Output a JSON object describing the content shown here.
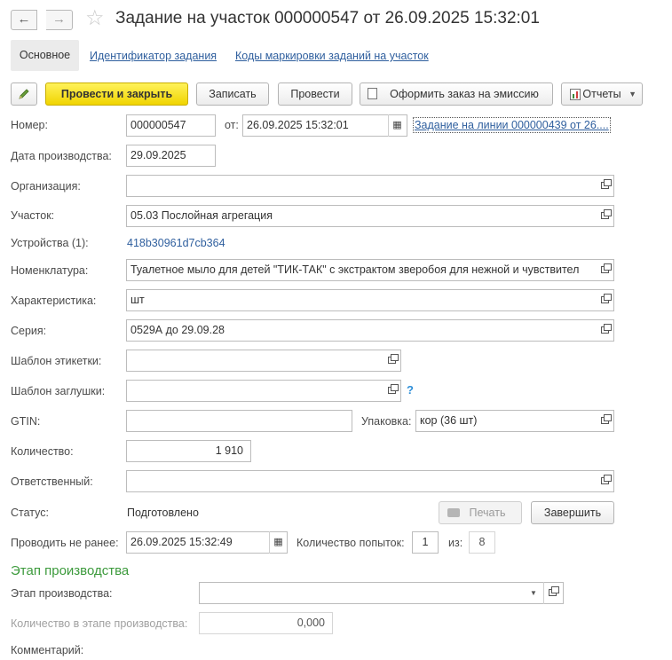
{
  "header": {
    "back_icon": "arrow-left-icon",
    "forward_icon": "arrow-right-icon",
    "star_icon": "star-icon",
    "title": "Задание на участок 000000547 от 26.09.2025 15:32:01"
  },
  "tabs": {
    "main": "Основное",
    "link1": "Идентификатор задания",
    "link2": "Коды маркировки заданий на участок"
  },
  "toolbar": {
    "post_close": "Провести и закрыть",
    "save": "Записать",
    "post": "Провести",
    "emission": "Оформить заказ на эмиссию",
    "reports": "Отчеты"
  },
  "form": {
    "number_label": "Номер:",
    "number": "000000547",
    "from_label": "от:",
    "date": "26.09.2025 15:32:01",
    "line_task_link": "Задание на линии 000000439 от 26....",
    "prod_date_label": "Дата производства:",
    "prod_date": "29.09.2025",
    "org_label": "Организация:",
    "org": "",
    "section_label": "Участок:",
    "section": "05.03 Послойная агрегация",
    "devices_label": "Устройства (1):",
    "devices": "418b30961d7cb364",
    "nomenclature_label": "Номенклатура:",
    "nomenclature": "Туалетное мыло для детей \"ТИК-ТАК\" с экстрактом зверобоя для нежной и чувствител",
    "characteristic_label": "Характеристика:",
    "characteristic": "шт",
    "series_label": "Серия:",
    "series": "0529А до 29.09.28",
    "label_template_label": "Шаблон этикетки:",
    "label_template": "",
    "stub_template_label": "Шаблон заглушки:",
    "stub_template": "",
    "help": "?",
    "gtin_label": "GTIN:",
    "gtin": "",
    "package_label": "Упаковка:",
    "package": "кор (36 шт)",
    "quantity_label": "Количество:",
    "quantity": "1 910",
    "responsible_label": "Ответственный:",
    "responsible": "",
    "status_label": "Статус:",
    "status": "Подготовлено",
    "print_btn": "Печать",
    "finish_btn": "Завершить",
    "not_before_label": "Проводить не ранее:",
    "not_before": "26.09.2025 15:32:49",
    "attempts_label": "Количество попыток:",
    "attempts": "1",
    "of_label": "из:",
    "attempts_max": "8"
  },
  "stage": {
    "section_title": "Этап производства",
    "stage_label": "Этап производства:",
    "stage": "",
    "qty_label": "Количество в этапе производства:",
    "qty": "0,000",
    "comment_label": "Комментарий:"
  }
}
